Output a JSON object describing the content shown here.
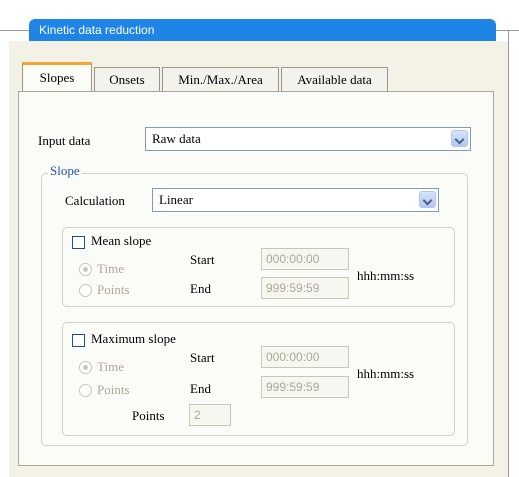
{
  "window": {
    "title": "Kinetic data reduction"
  },
  "tabs": [
    {
      "label": "Slopes",
      "active": true
    },
    {
      "label": "Onsets"
    },
    {
      "label": "Min./Max./Area"
    },
    {
      "label": "Available data"
    }
  ],
  "input": {
    "label": "Input data",
    "value": "Raw data"
  },
  "slope_group": {
    "title": "Slope",
    "calculation_label": "Calculation",
    "calculation_value": "Linear",
    "mean": {
      "label": "Mean slope",
      "checked": false,
      "radio_time": "Time",
      "radio_points": "Points",
      "start_label": "Start",
      "end_label": "End",
      "start_value": "000:00:00",
      "end_value": "999:59:59",
      "unit": "hhh:mm:ss"
    },
    "maximum": {
      "label": "Maximum slope",
      "checked": false,
      "radio_time": "Time",
      "radio_points": "Points",
      "start_label": "Start",
      "end_label": "End",
      "start_value": "000:00:00",
      "end_value": "999:59:59",
      "unit": "hhh:mm:ss",
      "points_label": "Points",
      "points_value": "2"
    }
  },
  "colors": {
    "title_bar": "#1e84e6",
    "active_tab_accent": "#f5a530",
    "legend_text": "#1f4fbe"
  },
  "icons": {
    "dropdown": "chevron-down-icon"
  }
}
